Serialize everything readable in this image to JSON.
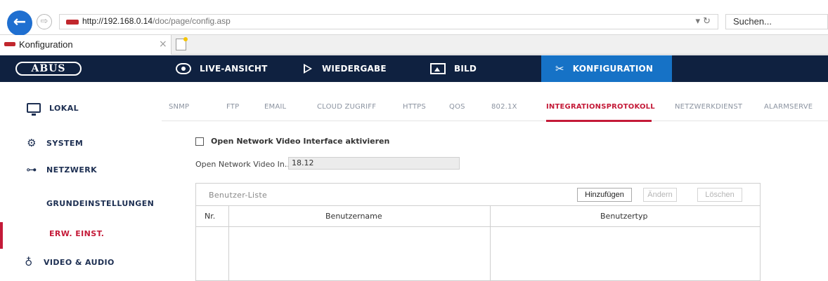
{
  "browser": {
    "url_host": "http://192.168.0.14",
    "url_path": "/doc/page/config.asp",
    "url_controls": "▾ ↻",
    "search_placeholder": "Suchen...",
    "tab_title": "Konfiguration",
    "tab_close": "×",
    "back_glyph": "←",
    "forward_glyph": "⇨"
  },
  "app": {
    "logo": "ABUS",
    "nav": [
      {
        "label": "LIVE-ANSICHT",
        "icon": "eye-icon"
      },
      {
        "label": "WIEDERGABE",
        "icon": "play-icon"
      },
      {
        "label": "BILD",
        "icon": "image-icon"
      },
      {
        "label": "KONFIGURATION",
        "icon": "tools-icon",
        "active": true
      }
    ]
  },
  "sidebar": {
    "items": [
      {
        "label": "LOKAL",
        "icon": "monitor-icon"
      },
      {
        "label": "SYSTEM",
        "icon": "gear-icon"
      },
      {
        "label": "NETZWERK",
        "icon": "network-icon"
      },
      {
        "label": "VIDEO & AUDIO",
        "icon": "microphone-icon"
      }
    ],
    "subitems": [
      {
        "label": "GRUNDEINSTELLUNGEN"
      },
      {
        "label": "ERW. EINST.",
        "active": true
      }
    ],
    "icon_glyphs": {
      "gear": "⚙",
      "network": "⊶",
      "microphone": "♁"
    }
  },
  "subtabs": [
    "SNMP",
    "FTP",
    "EMAIL",
    "CLOUD ZUGRIFF",
    "HTTPS",
    "QOS",
    "802.1X",
    "INTEGRATIONSPROTOKOLL",
    "NETZWERKDIENST",
    "ALARMSERVE"
  ],
  "active_subtab": "INTEGRATIONSPROTOKOLL",
  "form": {
    "checkbox_label": "Open Network Video Interface aktivieren",
    "checkbox_checked": false,
    "version_label": "Open Network Video In...",
    "version_value": "18.12"
  },
  "user_list": {
    "title": "Benutzer-Liste",
    "buttons": {
      "add": "Hinzufügen",
      "edit": "Ändern",
      "delete": "Löschen"
    },
    "columns": [
      "Nr.",
      "Benutzername",
      "Benutzertyp"
    ],
    "rows": []
  },
  "colors": {
    "header_bg": "#0f2140",
    "active_nav": "#1672c6",
    "accent_red": "#c41a38",
    "text_navy": "#1d2f52"
  }
}
